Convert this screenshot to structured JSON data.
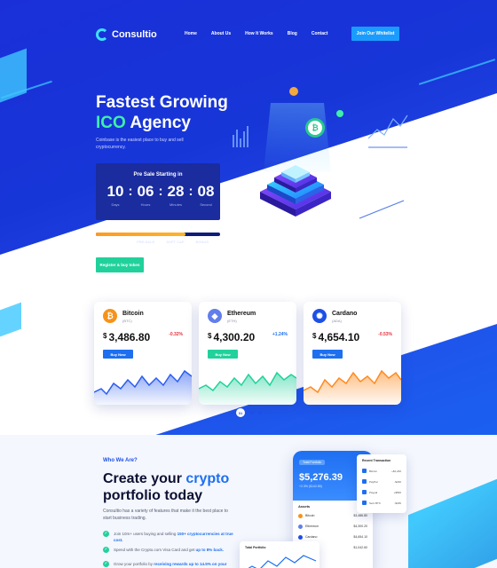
{
  "nav": {
    "logo_text": "Consultio",
    "links": [
      "Home",
      "About Us",
      "How It Works",
      "Blog",
      "Contact"
    ],
    "cta": "Join Our Whitelist"
  },
  "hero": {
    "title_line1": "Fastest Growing",
    "title_accent": "ICO",
    "title_line2_rest": " Agency",
    "subtitle": "Coinbase is the easiest place to buy and sell cryptocurrency.",
    "countdown": {
      "title": "Pre Sale Starting in",
      "days": "10",
      "hours": "06",
      "minutes": "28",
      "seconds": "08",
      "labels": [
        "Days",
        "Hours",
        "Minutes",
        "Second"
      ]
    },
    "progress_percent": 72,
    "progress_labels": [
      "PRE-SALE",
      "SOFT CAP",
      "BONUS"
    ],
    "register_button": "Register & buy token"
  },
  "coins": [
    {
      "name": "Bitcoin",
      "symbol": "(BTC)",
      "currency": "$",
      "price": "3,486.80",
      "change": "-0.32%",
      "buy": "Buy Now",
      "color": "#f7931a",
      "chart_color": "#2a5cf0",
      "glyph": "₿"
    },
    {
      "name": "Ethereum",
      "symbol": "(ETH)",
      "currency": "$",
      "price": "4,300.20",
      "change": "+1.24%",
      "buy": "Buy Now",
      "color": "#627eea",
      "chart_color": "#21d19b",
      "glyph": "◆"
    },
    {
      "name": "Cardano",
      "symbol": "(ADA)",
      "currency": "$",
      "price": "4,654.10",
      "change": "-0.53%",
      "buy": "Buy Now",
      "color": "#1d4fe8",
      "chart_color": "#ff8a1f",
      "glyph": "✺"
    }
  ],
  "pagination": {
    "active": "01"
  },
  "about": {
    "eyebrow": "Who We Are?",
    "title_line1_pre": "Create your ",
    "title_accent": "crypto",
    "title_line2": "portfolio today",
    "paragraph": "Consultio has a variety of features that make it the best place to start business trading.",
    "bullets": [
      {
        "pre": "Join 10m+ users buying and selling ",
        "hl": "150+ cryptocurrencies at true cost."
      },
      {
        "pre": "Spend with the Crypto.com Visa Card and get ",
        "hl": "up to 8% back."
      },
      {
        "pre": "Grow your portfolio by ",
        "hl": "receiving rewards up to 14.5% on your"
      }
    ]
  },
  "phone": {
    "tab": "Total Portfolio",
    "balance": "$5,276.39",
    "balance_sub": "+2.3% ($142.85)",
    "section": "Assets",
    "rows": [
      {
        "name": "Bitcoin",
        "value": "$3,486.80",
        "color": "#f7931a"
      },
      {
        "name": "Ethereum",
        "value": "$4,300.20",
        "color": "#627eea"
      },
      {
        "name": "Cardano",
        "value": "$4,654.10",
        "color": "#1d4fe8"
      },
      {
        "name": "Ripple",
        "value": "$1,042.60",
        "color": "#21d19b"
      }
    ]
  },
  "transactions": {
    "title": "Recent Transaction",
    "rows": [
      {
        "name": "Bitcoin",
        "amount": "+$1,240"
      },
      {
        "name": "PayPal",
        "amount": "-$230"
      },
      {
        "name": "Paypal",
        "amount": "+$560"
      },
      {
        "name": "Sent BTC",
        "amount": "-$180"
      }
    ]
  },
  "portfolio_card": {
    "title": "Total Portfolio"
  }
}
